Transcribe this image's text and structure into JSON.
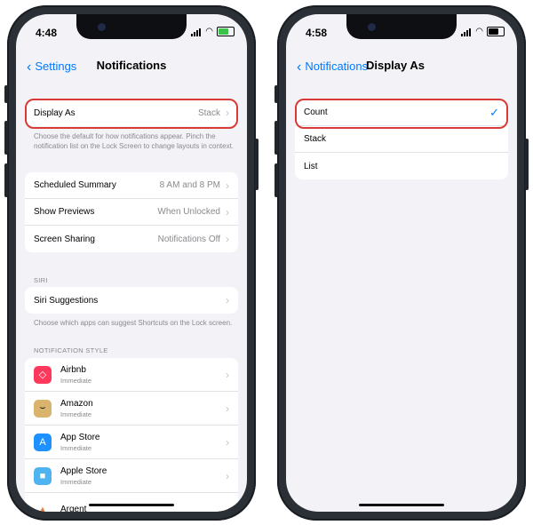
{
  "colors": {
    "accent": "#007aff",
    "highlight": "#d93a35",
    "background": "#f2f2f7"
  },
  "left": {
    "status_time": "4:48",
    "nav": {
      "back_label": "Settings",
      "title": "Notifications"
    },
    "display_as": {
      "label": "Display As",
      "value": "Stack"
    },
    "display_note": "Choose the default for how notifications appear. Pinch the notification list on the Lock Screen to change layouts in context.",
    "settings": [
      {
        "label": "Scheduled Summary",
        "value": "8 AM and 8 PM"
      },
      {
        "label": "Show Previews",
        "value": "When Unlocked"
      },
      {
        "label": "Screen Sharing",
        "value": "Notifications Off"
      }
    ],
    "siri_header": "SIRI",
    "siri_suggestions": "Siri Suggestions",
    "siri_note": "Choose which apps can suggest Shortcuts on the Lock screen.",
    "style_header": "NOTIFICATION STYLE",
    "apps": [
      {
        "name": "Airbnb",
        "sub": "Immediate",
        "icon": "airbnb-icon",
        "color": "#ff385c"
      },
      {
        "name": "Amazon",
        "sub": "Immediate",
        "icon": "amazon-icon",
        "color": "#d9b46d"
      },
      {
        "name": "App Store",
        "sub": "Immediate",
        "icon": "app-store-icon",
        "color": "#1e90ff"
      },
      {
        "name": "Apple Store",
        "sub": "Immediate",
        "icon": "apple-store-icon",
        "color": "#4fb3f0"
      },
      {
        "name": "Argent",
        "sub": "",
        "icon": "argent-icon",
        "color": "#f27a3c"
      }
    ]
  },
  "right": {
    "status_time": "4:58",
    "nav": {
      "back_label": "Notifications",
      "title": "Display As"
    },
    "options": [
      {
        "label": "Count",
        "selected": true
      },
      {
        "label": "Stack",
        "selected": false
      },
      {
        "label": "List",
        "selected": false
      }
    ],
    "check_glyph": "✓"
  }
}
